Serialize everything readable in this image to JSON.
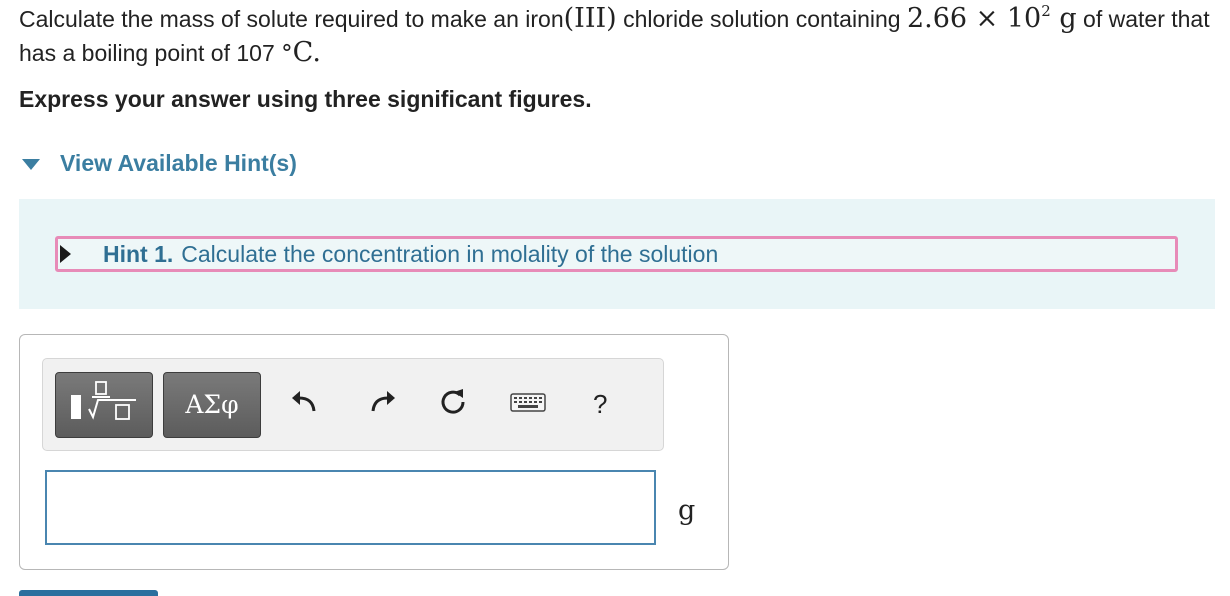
{
  "question": {
    "part1": "Calculate the mass of solute required to make an iron",
    "roman": "(III)",
    "part2": " chloride solution containing ",
    "mass_value": "2.66",
    "times": " × ",
    "base": "10",
    "exponent": "2",
    "mass_unit": " g",
    "part3": " of water that has a boiling point of 107 ",
    "degree": "°",
    "temp_unit": "C",
    "period": "."
  },
  "instruction": "Express your answer using three significant figures.",
  "hints": {
    "toggle_label": "View Available Hint(s)",
    "items": [
      {
        "title": "Hint 1.",
        "text": "Calculate the concentration in molality of the solution"
      }
    ]
  },
  "toolbar": {
    "greek_label": "ΑΣφ",
    "help_label": "?",
    "icons": [
      "templates-icon",
      "greek-symbols-icon",
      "undo-icon",
      "redo-icon",
      "reset-icon",
      "keyboard-icon",
      "help-icon"
    ]
  },
  "answer": {
    "value": "",
    "unit": "g"
  },
  "colors": {
    "link": "#3b7ea1",
    "hint_panel_bg": "#e9f5f7",
    "hint_border": "#e78bb8",
    "input_border": "#4a86b0"
  }
}
